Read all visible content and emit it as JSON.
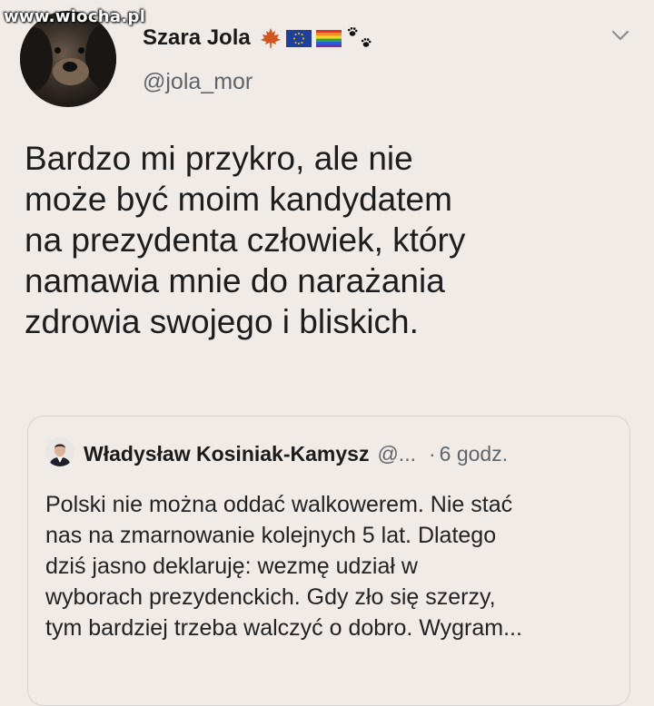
{
  "watermark": "www.wiocha.pl",
  "author": {
    "display_name": "Szara Jola",
    "handle": "@jola_mor",
    "emoji": [
      "maple-leaf-icon",
      "eu-flag-icon",
      "rainbow-flag-icon",
      "paw-prints-icon"
    ]
  },
  "tweet": {
    "lines": [
      "Bardzo mi przykro, ale nie",
      "może być moim kandydatem",
      "na prezydenta człowiek, który",
      "namawia mnie do narażania",
      "zdrowia swojego i bliskich."
    ]
  },
  "quote": {
    "name": "Władysław Kosiniak-Kamysz",
    "handle": "@...",
    "separator": "·",
    "time": "6 godz.",
    "lines": [
      "Polski nie można oddać walkowerem. Nie stać",
      "nas na zmarnowanie kolejnych 5 lat. Dlatego",
      "dziś jasno deklaruję: wezmę udział w",
      "wyborach prezydenckich. Gdy zło się szerzy,",
      "tym bardziej trzeba walczyć o dobro. Wygram..."
    ]
  },
  "colors": {
    "background": "#f1ebe8",
    "text": "#1d1d1d",
    "secondary_text": "#5f6468",
    "border": "#d6d2cf"
  }
}
